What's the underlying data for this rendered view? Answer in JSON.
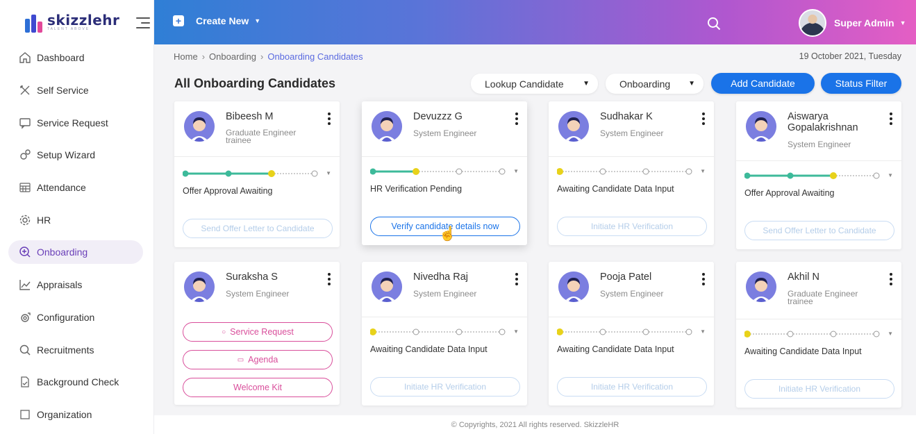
{
  "brand": {
    "name": "skizzlehr",
    "tagline": "TALENT ABOVE"
  },
  "sidebar": {
    "items": [
      {
        "label": "Dashboard",
        "icon": "home-icon"
      },
      {
        "label": "Self Service",
        "icon": "tools-icon"
      },
      {
        "label": "Service Request",
        "icon": "chat-icon"
      },
      {
        "label": "Setup Wizard",
        "icon": "gears-icon"
      },
      {
        "label": "Attendance",
        "icon": "calendar-grid-icon"
      },
      {
        "label": "HR",
        "icon": "cog-icon"
      },
      {
        "label": "Onboarding",
        "icon": "search-plus-icon",
        "active": true
      },
      {
        "label": "Appraisals",
        "icon": "trend-chart-icon"
      },
      {
        "label": "Configuration",
        "icon": "config-icon"
      },
      {
        "label": "Recruitments",
        "icon": "magnifier-icon"
      },
      {
        "label": "Background Check",
        "icon": "document-check-icon"
      },
      {
        "label": "Organization",
        "icon": "org-icon"
      }
    ]
  },
  "header": {
    "create_new": "Create New",
    "user_name": "Super Admin"
  },
  "breadcrumb": {
    "home": "Home",
    "section": "Onboarding",
    "current": "Onboarding Candidates"
  },
  "date": "19 October 2021, Tuesday",
  "page_title": "All Onboarding Candidates",
  "filters": {
    "lookup": "Lookup Candidate",
    "stage": "Onboarding"
  },
  "buttons": {
    "add_candidate": "Add Candidate",
    "status_filter": "Status Filter"
  },
  "cards": [
    {
      "name": "Bibeesh M",
      "role": "Graduate Engineer trainee",
      "status": "Offer Approval Awaiting",
      "progress_step": 3,
      "action": "Send Offer Letter to Candidate"
    },
    {
      "name": "Devuzzz G",
      "role": "System Engineer",
      "status": "HR Verification Pending",
      "progress_step": 2,
      "action": "Verify candidate details now"
    },
    {
      "name": "Sudhakar K",
      "role": "System Engineer",
      "status": "Awaiting Candidate Data Input",
      "progress_step": 1,
      "action": "Initiate HR Verification"
    },
    {
      "name": "Aiswarya Gopalakrishnan",
      "role": "System Engineer",
      "status": "Offer Approval Awaiting",
      "progress_step": 3,
      "action": "Send Offer Letter to Candidate"
    },
    {
      "name": "Suraksha S",
      "role": "System Engineer",
      "actions": [
        "Service Request",
        "Agenda",
        "Welcome Kit"
      ]
    },
    {
      "name": "Nivedha Raj",
      "role": "System Engineer",
      "status": "Awaiting Candidate Data Input",
      "progress_step": 1,
      "action": "Initiate HR Verification"
    },
    {
      "name": "Pooja Patel",
      "role": "System Engineer",
      "status": "Awaiting Candidate Data Input",
      "progress_step": 1,
      "action": "Initiate HR Verification"
    },
    {
      "name": "Akhil N",
      "role": "Graduate Engineer trainee",
      "status": "Awaiting Candidate Data Input",
      "progress_step": 1,
      "action": "Initiate HR Verification"
    }
  ],
  "colors": {
    "progress_done": "#3dba9a",
    "progress_current": "#e8d21a",
    "accent": "#1a73e8",
    "pink": "#d94e9b"
  },
  "footer": "© Copyrights, 2021 All rights reserved. SkizzleHR"
}
